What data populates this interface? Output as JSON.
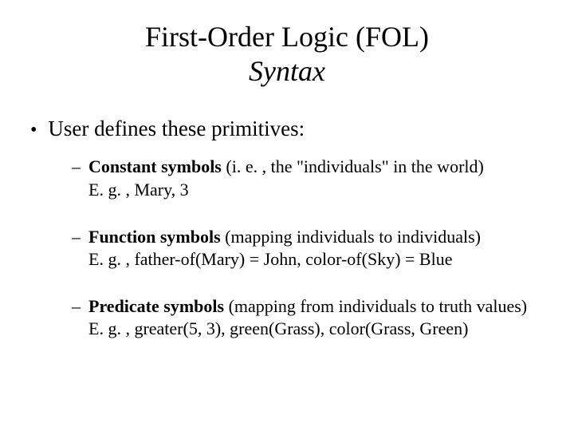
{
  "title": {
    "line1": "First-Order Logic (FOL)",
    "line2": "Syntax"
  },
  "bullet": {
    "marker": "•",
    "text": "User defines these primitives:"
  },
  "sub_marker": "–",
  "items": [
    {
      "bold": "Constant symbols",
      "rest": " (i. e. , the \"individuals\" in the world)",
      "example": "E. g. , Mary, 3"
    },
    {
      "bold": "Function symbols",
      "rest": " (mapping individuals to individuals)",
      "example": "E. g. , father-of(Mary) = John, color-of(Sky) = Blue"
    },
    {
      "bold": "Predicate symbols",
      "rest": " (mapping from individuals to truth values)",
      "example": "E. g. , greater(5, 3), green(Grass), color(Grass, Green)"
    }
  ]
}
